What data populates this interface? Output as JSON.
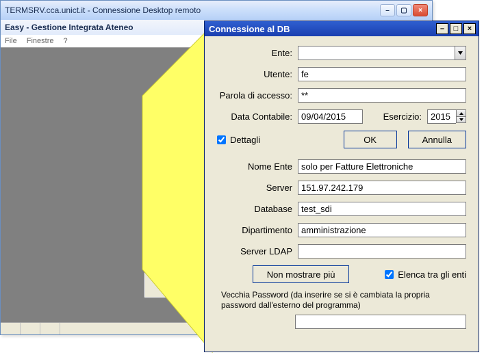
{
  "rdp": {
    "title": "TERMSRV.cca.unict.it - Connessione Desktop remoto",
    "min_label": "–",
    "max_label": "▢",
    "close_label": "×"
  },
  "easy": {
    "title": "Easy - Gestione Integrata Ateneo",
    "menu_file": "File",
    "menu_finestre": "Finestre",
    "menu_help": "?",
    "min_label": "–",
    "max_label": "▢",
    "close_label": "×"
  },
  "thumb": {
    "title": "Connessione al DB",
    "ente_label": "Ente:",
    "utente_label": "Utente:",
    "utente_value": "fe",
    "parola_label": "Parola di accesso",
    "data_label": "Data Contabile:",
    "dettagli_label": "Dettagli",
    "nome_ente_label": "Nome Ente",
    "nome_ente_value": "sol",
    "server_label": "Server",
    "server_value": "15",
    "database_label": "Database",
    "database_value": "tes",
    "dipartimento_label": "Dipartimento",
    "dipartimento_value": "am",
    "server_ldap_label": "Server LDAP",
    "non_most_btn": "Non mo",
    "nota": "Vecchia Password (da inserire se dall'esterno del programma)"
  },
  "dialog": {
    "title": "Connessione al DB",
    "min_label": "–",
    "max_label": "□",
    "close_label": "×",
    "ente_label": "Ente:",
    "ente_value": "",
    "utente_label": "Utente:",
    "utente_value": "fe",
    "parola_label": "Parola di accesso:",
    "parola_value": "**",
    "data_label": "Data Contabile:",
    "data_value": "09/04/2015",
    "esercizio_label": "Esercizio:",
    "esercizio_value": "2015",
    "dettagli_label": "Dettagli",
    "ok_label": "OK",
    "annulla_label": "Annulla",
    "nome_ente_label": "Nome Ente",
    "nome_ente_value": "solo per Fatture Elettroniche",
    "server_label": "Server",
    "server_value": "151.97.242.179",
    "database_label": "Database",
    "database_value": "test_sdi",
    "dipartimento_label": "Dipartimento",
    "dipartimento_value": "amministrazione",
    "server_ldap_label": "Server LDAP",
    "server_ldap_value": "",
    "non_mostrare_label": "Non mostrare più",
    "elenca_label": "Elenca tra gli enti",
    "vecchia_pw_note": "Vecchia Password (da inserire se si è cambiata la propria password dall'esterno del programma)",
    "vecchia_pw_value": ""
  }
}
